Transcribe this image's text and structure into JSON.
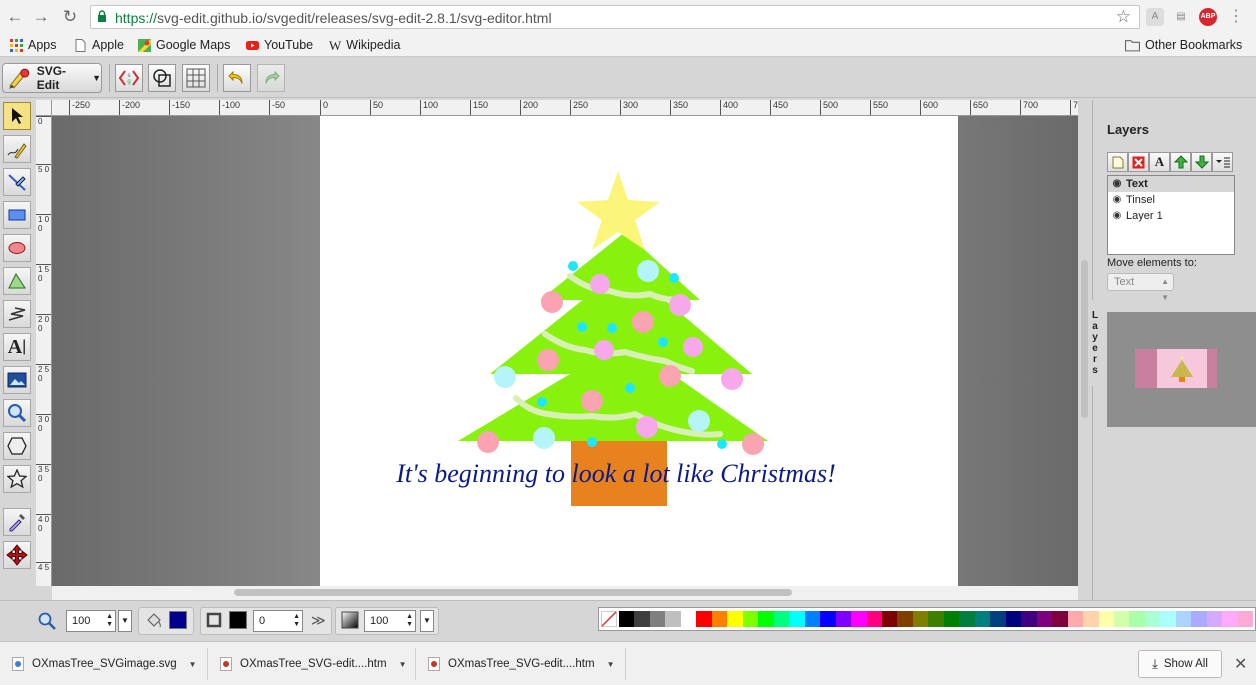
{
  "browser": {
    "url_scheme": "https://",
    "url_rest": "svg-edit.github.io/svgedit/releases/svg-edit-2.8.1/svg-editor.html",
    "extension_abp_label": "ABP",
    "bookmarks": [
      {
        "label": "Apps",
        "icon": "apps-grid-icon"
      },
      {
        "label": "Apple",
        "icon": "page-icon"
      },
      {
        "label": "Google Maps",
        "icon": "maps-icon"
      },
      {
        "label": "YouTube",
        "icon": "youtube-icon"
      },
      {
        "label": "Wikipedia",
        "icon": "wikipedia-icon"
      }
    ],
    "other_bookmarks": "Other Bookmarks"
  },
  "editor": {
    "menu_label": "SVG-Edit",
    "ruler_x": [
      "-250",
      "-200",
      "-150",
      "-100",
      "-50",
      "0",
      "50",
      "100",
      "150",
      "200",
      "250",
      "300",
      "350",
      "400",
      "450",
      "500",
      "550",
      "600",
      "650",
      "700",
      "7"
    ],
    "ruler_y": [
      "0",
      "5 0",
      "1 0 0",
      "1 5 0",
      "2 0 0",
      "2 5 0",
      "3 0 0",
      "3 5 0",
      "4 0 0",
      "4 5"
    ],
    "canvas": {
      "caption": "It's beginning to look a lot like Christmas!",
      "caption_color": "#0a1a8a",
      "tree_color": "#88f20e",
      "star_color": "#fbf57a",
      "trunk_color": "#e8821f"
    }
  },
  "layers_panel": {
    "title": "Layers",
    "handle_label": "L a y e r s",
    "layers": [
      {
        "name": "Text",
        "selected": true
      },
      {
        "name": "Tinsel",
        "selected": false
      },
      {
        "name": "Layer 1",
        "selected": false
      }
    ],
    "move_label": "Move elements to:",
    "move_value": "Text"
  },
  "bottom_tools": {
    "zoom_value": "100",
    "stroke_width": "0",
    "opacity_value": "100",
    "fill_color": "#00008b",
    "stroke_color": "#000000",
    "more_label": "≫"
  },
  "palette": [
    "#000000",
    "#3f3f3f",
    "#7f7f7f",
    "#bfbfbf",
    "#ffffff",
    "#ff0000",
    "#ff7f00",
    "#ffff00",
    "#7fff00",
    "#00ff00",
    "#00ff7f",
    "#00ffff",
    "#007fff",
    "#0000ff",
    "#7f00ff",
    "#ff00ff",
    "#ff007f",
    "#7f0000",
    "#7f3f00",
    "#7f7f00",
    "#3f7f00",
    "#007f00",
    "#007f3f",
    "#007f7f",
    "#003f7f",
    "#00007f",
    "#3f007f",
    "#7f007f",
    "#7f003f",
    "#ffaaaa",
    "#ffd4aa",
    "#ffffaa",
    "#d4ffaa",
    "#aaffaa",
    "#aaffd4",
    "#aaffff",
    "#aad4ff",
    "#aaaaff",
    "#d4aaff",
    "#ffaaff",
    "#ffaad4"
  ],
  "downloads": [
    {
      "name": "OXmasTree_SVGimage.svg"
    },
    {
      "name": "OXmasTree_SVG-edit....htm"
    },
    {
      "name": "OXmasTree_SVG-edit....htm"
    }
  ],
  "show_all": "Show All"
}
